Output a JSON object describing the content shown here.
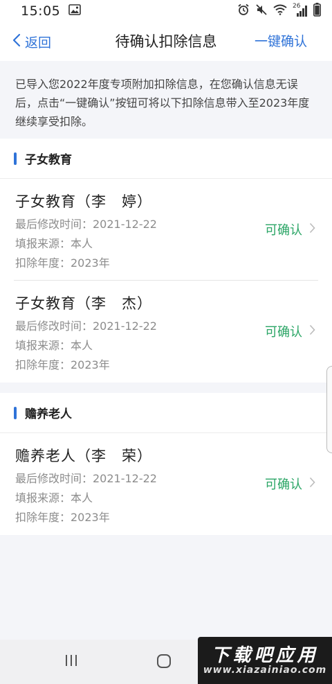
{
  "status_bar": {
    "time": "15:05",
    "network_label": "26"
  },
  "nav": {
    "back_label": "返回",
    "title": "待确认扣除信息",
    "confirm_all_label": "一键确认"
  },
  "notice_text": "已导入您2022年度专项附加扣除信息，在您确认信息无误后，点击“一键确认”按钮可将以下扣除信息带入至2023年度继续享受扣除。",
  "sections": [
    {
      "title": "子女教育",
      "items": [
        {
          "name": "子女教育（李　婷）",
          "modified": "最后修改时间：2021-12-22",
          "source": "填报来源：本人",
          "year": "扣除年度：2023年",
          "status": "可确认"
        },
        {
          "name": "子女教育（李　杰）",
          "modified": "最后修改时间：2021-12-22",
          "source": "填报来源：本人",
          "year": "扣除年度：2023年",
          "status": "可确认"
        }
      ]
    },
    {
      "title": "赡养老人",
      "items": [
        {
          "name": "赡养老人（李　荣）",
          "modified": "最后修改时间：2021-12-22",
          "source": "填报来源：本人",
          "year": "扣除年度：2023年",
          "status": "可确认"
        }
      ]
    }
  ],
  "watermark": {
    "main": "下载吧应用",
    "sub": "www.xiazainiao.com"
  },
  "colors": {
    "accent": "#2f73d8",
    "status_green": "#2aa565",
    "page_bg": "#f4f5f9"
  }
}
